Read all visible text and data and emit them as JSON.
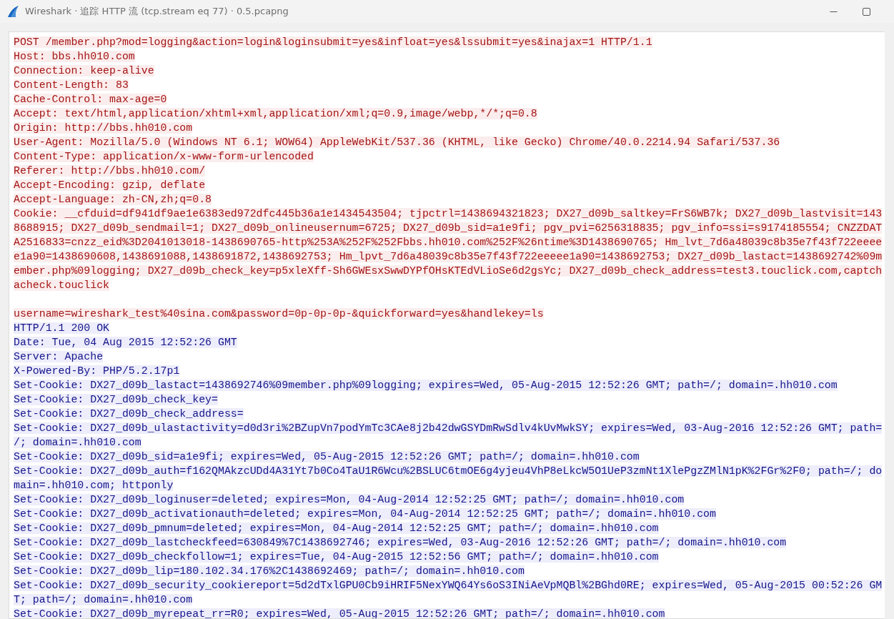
{
  "window": {
    "title": "Wireshark · 追踪 HTTP 流 (tcp.stream eq 77) · 0.5.pcapng"
  },
  "segments": [
    {
      "kind": "client",
      "lines": [
        "POST /member.php?mod=logging&action=login&loginsubmit=yes&infloat=yes&lssubmit=yes&inajax=1 HTTP/1.1",
        "Host: bbs.hh010.com",
        "Connection: keep-alive",
        "Content-Length: 83",
        "Cache-Control: max-age=0",
        "Accept: text/html,application/xhtml+xml,application/xml;q=0.9,image/webp,*/*;q=0.8",
        "Origin: http://bbs.hh010.com",
        "User-Agent: Mozilla/5.0 (Windows NT 6.1; WOW64) AppleWebKit/537.36 (KHTML, like Gecko) Chrome/40.0.2214.94 Safari/537.36",
        "Content-Type: application/x-www-form-urlencoded",
        "Referer: http://bbs.hh010.com/",
        "Accept-Encoding: gzip, deflate",
        "Accept-Language: zh-CN,zh;q=0.8",
        "Cookie: __cfduid=df941df9ae1e6383ed972dfc445b36a1e1434543504; tjpctrl=1438694321823; DX27_d09b_saltkey=FrS6WB7k; DX27_d09b_lastvisit=1438688915; DX27_d09b_sendmail=1; DX27_d09b_onlineusernum=6725; DX27_d09b_sid=a1e9fi; pgv_pvi=6256318835; pgv_info=ssi=s9174185554; CNZZDATA2516833=cnzz_eid%3D2041013018-1438690765-http%253A%252F%252Fbbs.hh010.com%252F%26ntime%3D1438690765; Hm_lvt_7d6a48039c8b35e7f43f722eeeee1a90=1438690608,1438691088,1438691872,1438692753; Hm_lpvt_7d6a48039c8b35e7f43f722eeeee1a90=1438692753; DX27_d09b_lastact=1438692742%09member.php%09logging; DX27_d09b_check_key=p5xleXff-Sh6GWEsxSwwDYPfOHsKTEdVLioSe6d2gsYc; DX27_d09b_check_address=test3.touclick.com,captchacheck.touclick"
      ]
    },
    {
      "kind": "client",
      "lines": [
        "username=wireshark_test%40sina.com&password=0p-0p-0p-&quickforward=yes&handlekey=ls"
      ]
    },
    {
      "kind": "server",
      "lines": [
        "HTTP/1.1 200 OK",
        "Date: Tue, 04 Aug 2015 12:52:26 GMT",
        "Server: Apache",
        "X-Powered-By: PHP/5.2.17p1",
        "Set-Cookie: DX27_d09b_lastact=1438692746%09member.php%09logging; expires=Wed, 05-Aug-2015 12:52:26 GMT; path=/; domain=.hh010.com",
        "Set-Cookie: DX27_d09b_check_key=",
        "Set-Cookie: DX27_d09b_check_address=",
        "Set-Cookie: DX27_d09b_ulastactivity=d0d3ri%2BZupVn7podYmTc3CAe8j2b42dwGSYDmRwSdlv4kUvMwkSY; expires=Wed, 03-Aug-2016 12:52:26 GMT; path=/; domain=.hh010.com",
        "Set-Cookie: DX27_d09b_sid=a1e9fi; expires=Wed, 05-Aug-2015 12:52:26 GMT; path=/; domain=.hh010.com",
        "Set-Cookie: DX27_d09b_auth=f162QMAkzcUDd4A31Yt7b0Co4TaU1R6Wcu%2BSLUC6tmOE6g4yjeu4VhP8eLkcW5O1UeP3zmNt1XlePgzZMlN1pK%2FGr%2F0; path=/; domain=.hh010.com; httponly",
        "Set-Cookie: DX27_d09b_loginuser=deleted; expires=Mon, 04-Aug-2014 12:52:25 GMT; path=/; domain=.hh010.com",
        "Set-Cookie: DX27_d09b_activationauth=deleted; expires=Mon, 04-Aug-2014 12:52:25 GMT; path=/; domain=.hh010.com",
        "Set-Cookie: DX27_d09b_pmnum=deleted; expires=Mon, 04-Aug-2014 12:52:25 GMT; path=/; domain=.hh010.com",
        "Set-Cookie: DX27_d09b_lastcheckfeed=630849%7C1438692746; expires=Wed, 03-Aug-2016 12:52:26 GMT; path=/; domain=.hh010.com",
        "Set-Cookie: DX27_d09b_checkfollow=1; expires=Tue, 04-Aug-2015 12:52:56 GMT; path=/; domain=.hh010.com",
        "Set-Cookie: DX27_d09b_lip=180.102.34.176%2C1438692469; path=/; domain=.hh010.com",
        "Set-Cookie: DX27_d09b_security_cookiereport=5d2dTxlGPU0Cb9iHRIF5NexYWQ64Ys6oS3INiAeVpMQBl%2BGhd0RE; expires=Wed, 05-Aug-2015 00:52:26 GMT; path=/; domain=.hh010.com",
        "Set-Cookie: DX27_d09b_myrepeat_rr=R0; expires=Wed, 05-Aug-2015 12:52:26 GMT; path=/; domain=.hh010.com"
      ]
    }
  ]
}
